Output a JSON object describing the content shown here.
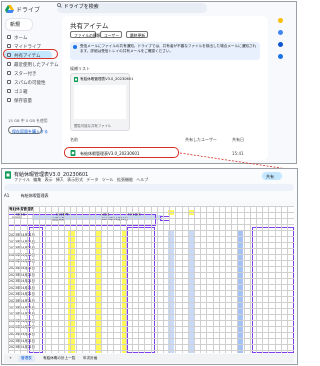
{
  "drive": {
    "app_name": "ドライブ",
    "search_placeholder": "ドライブを検索",
    "new_button": "新規",
    "nav": [
      {
        "label": "ホーム",
        "icon": "home-icon"
      },
      {
        "label": "マイドライブ",
        "icon": "drive-icon"
      },
      {
        "label": "パソコン",
        "icon": "computer-icon"
      },
      {
        "label": "共有アイテム",
        "icon": "shared-icon",
        "active": true
      },
      {
        "label": "最近使用したアイテム",
        "icon": "clock-icon"
      },
      {
        "label": "スター付き",
        "icon": "star-icon"
      },
      {
        "label": "スパムの可能性",
        "icon": "spam-icon"
      },
      {
        "label": "ゴミ箱",
        "icon": "trash-icon"
      },
      {
        "label": "保存容量",
        "icon": "cloud-icon"
      }
    ],
    "storage_text": "15 GB 中 0 GB を使用",
    "storage_button": "保存容量を購入する",
    "page_title": "共有アイテム",
    "filters": [
      "ファイルの種類",
      "ユーザー",
      "最終更新"
    ],
    "notice": "受信メールにファイルの共有通知。ドライブでは、共有者が不審なファイルを検出した場合メールに通知されます。詳細は受信トレイの共有メールをご確認ください。",
    "suggested_label": "候補リスト",
    "suggested_file": "有給休暇管理表V3.0_20230601",
    "suggested_foot": "閲覧可能な共有ファイル",
    "columns": {
      "name": "名前",
      "shared_by": "共有したユーザー",
      "date": "共有日"
    },
    "file_row": {
      "name": "有給休暇管理表V3.0_20230601",
      "date": "15:41"
    }
  },
  "sheets": {
    "doc_title": "有給休暇管理表V3.0_20230601",
    "menu": [
      "ファイル",
      "編集",
      "表示",
      "挿入",
      "表示形式",
      "データ",
      "ツール",
      "拡張機能",
      "ヘルプ"
    ],
    "share_label": "共有",
    "cell_ref": "A1",
    "formula": "有給休暇管理表",
    "header_title": "有給休暇管理表",
    "labels": {
      "name": "社員名",
      "id": "社員番号",
      "hire": "入社日",
      "grant": "付与日数"
    },
    "values": {
      "employee_id": "00001",
      "name": "山田太郎",
      "hire_date": "2015年04月01日"
    },
    "row_dates": [
      "2023年04月01日",
      "2023年04月01日",
      "2023年04月01日",
      "2023年04月01日",
      "2023年04月01日",
      "2023年04月01日",
      "2023年04月01日",
      "2023年04月01日",
      "2023年04月01日",
      "2023年04月01日",
      "2023年04月01日",
      "2023年04月01日",
      "2023年04月01日",
      "2023年04月01日",
      "2023年04月01日",
      "2023年04月01日",
      "2023年04月01日",
      "2023年04月01日"
    ],
    "tabs": [
      "管理表",
      "有給休暇の計上一覧",
      "年次計画"
    ]
  }
}
